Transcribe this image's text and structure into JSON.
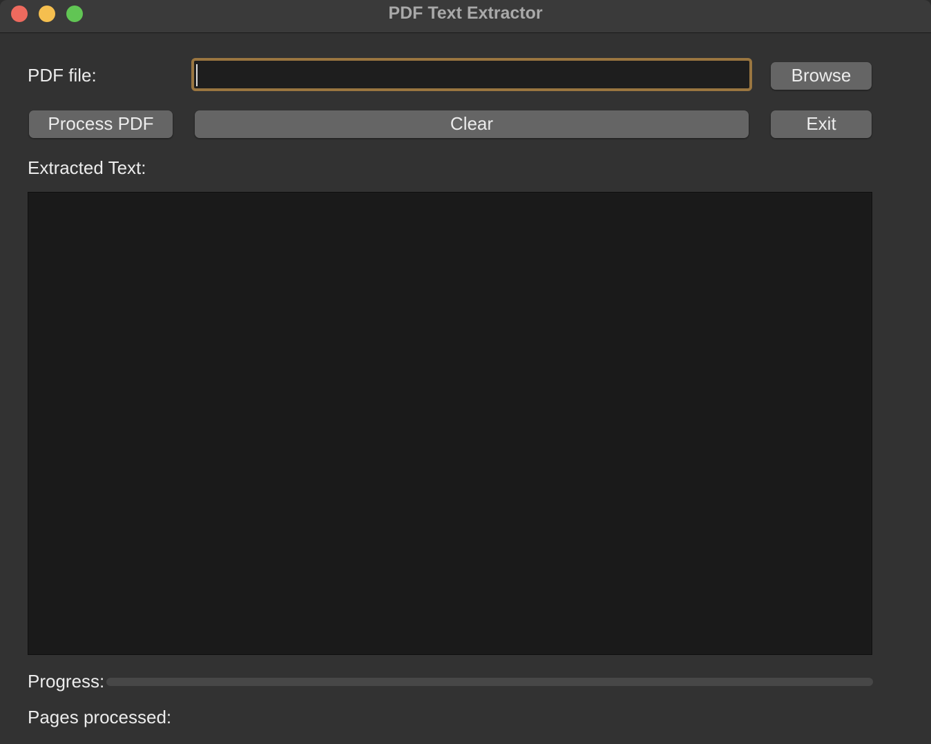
{
  "window": {
    "title": "PDF Text Extractor"
  },
  "file_row": {
    "label": "PDF file:",
    "input_value": "",
    "browse_label": "Browse"
  },
  "actions": {
    "process_label": "Process PDF",
    "clear_label": "Clear",
    "exit_label": "Exit"
  },
  "output": {
    "label": "Extracted Text:",
    "text": ""
  },
  "status": {
    "progress_label": "Progress:",
    "progress_value": 0,
    "pages_label": "Pages processed:",
    "pages_value": ""
  },
  "colors": {
    "focus_ring": "#9a7640",
    "button": "#656565",
    "text_area_bg": "#1a1a1a"
  }
}
